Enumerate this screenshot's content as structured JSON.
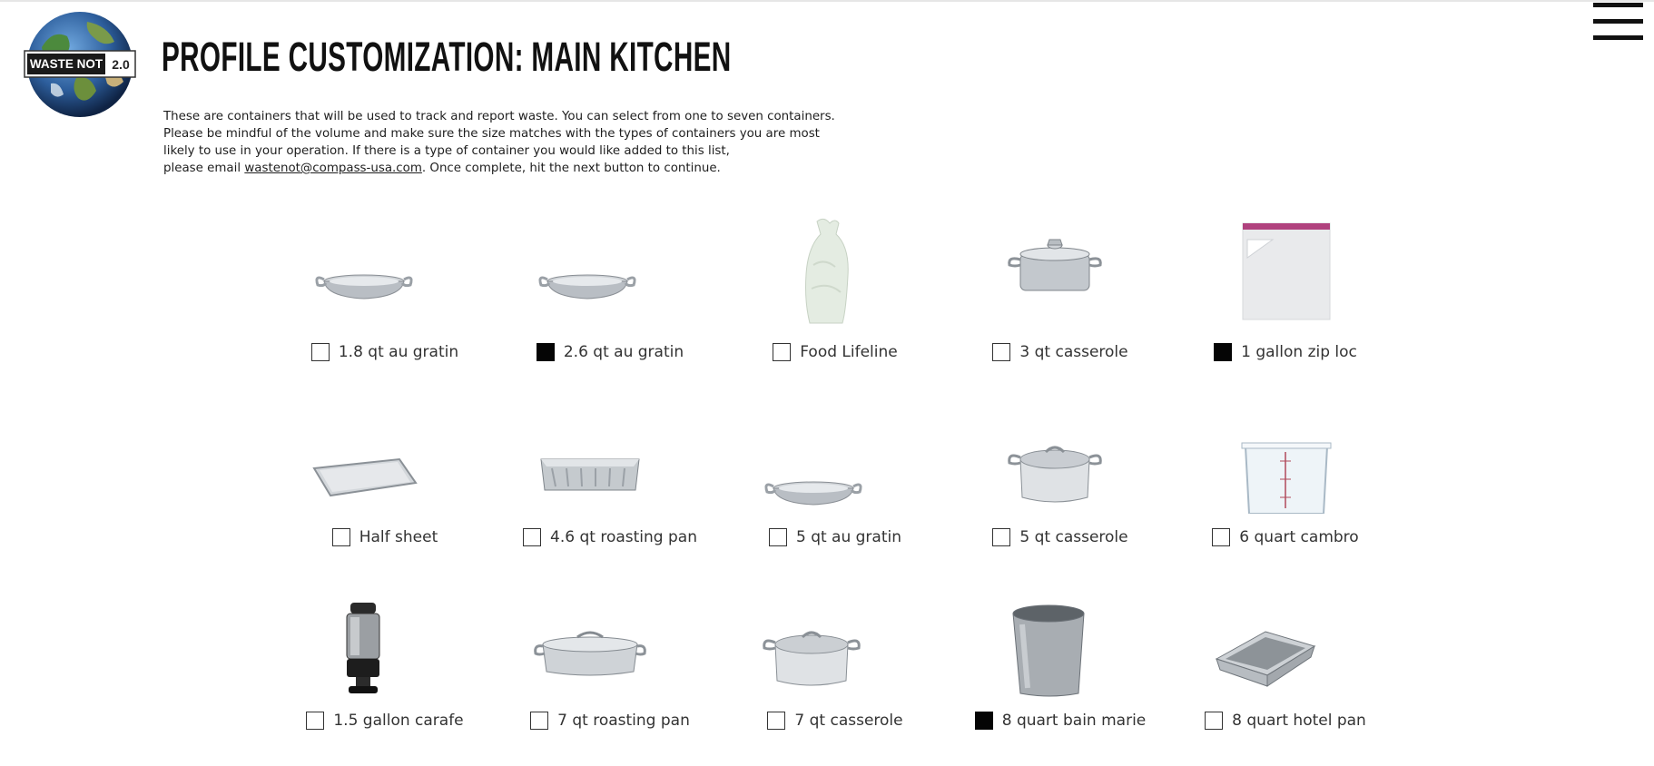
{
  "header": {
    "logo_text": "WASTE NOT",
    "logo_version": "2.0",
    "title": "PROFILE CUSTOMIZATION: MAIN KITCHEN",
    "menu_icon": "hamburger-menu-icon"
  },
  "description": {
    "line1": "These are containers that will be used to track and report waste. You can select from one to seven containers.",
    "line2": "Please be mindful of the volume and make sure the size matches with the types of containers you are most",
    "line3": "likely to use in your operation. If there is a type of container you would like added to this list,",
    "line4_prefix": "please email ",
    "email": "wastenot@compass-usa.com",
    "line4_suffix": ". Once complete, hit the next button to continue."
  },
  "containers": [
    {
      "label": "1.8 qt au gratin",
      "checked": false,
      "icon": "au-gratin-pan-icon"
    },
    {
      "label": "2.6 qt au gratin",
      "checked": true,
      "icon": "au-gratin-pan-icon"
    },
    {
      "label": "Food Lifeline",
      "checked": false,
      "icon": "plastic-bag-icon"
    },
    {
      "label": "3 qt casserole",
      "checked": false,
      "icon": "casserole-pot-icon"
    },
    {
      "label": "1 gallon zip loc",
      "checked": true,
      "icon": "zip-bag-icon"
    },
    {
      "label": "Half sheet",
      "checked": false,
      "icon": "sheet-pan-icon"
    },
    {
      "label": "4.6 qt roasting pan",
      "checked": false,
      "icon": "roasting-pan-icon"
    },
    {
      "label": "5 qt au gratin",
      "checked": false,
      "icon": "au-gratin-pan-icon"
    },
    {
      "label": "5 qt casserole",
      "checked": false,
      "icon": "casserole-pot-icon"
    },
    {
      "label": "6 quart cambro",
      "checked": false,
      "icon": "cambro-container-icon"
    },
    {
      "label": "1.5 gallon carafe",
      "checked": false,
      "icon": "carafe-icon"
    },
    {
      "label": "7 qt roasting pan",
      "checked": false,
      "icon": "roasting-pan-icon"
    },
    {
      "label": "7 qt casserole",
      "checked": false,
      "icon": "casserole-pot-icon"
    },
    {
      "label": "8 quart bain marie",
      "checked": true,
      "icon": "bain-marie-icon"
    },
    {
      "label": "8 quart hotel pan",
      "checked": false,
      "icon": "hotel-pan-icon"
    }
  ],
  "colors": {
    "checkbox_checked": "#050505",
    "zip_seal": "#b0427e",
    "logo_ocean": "#2d5e9c"
  }
}
